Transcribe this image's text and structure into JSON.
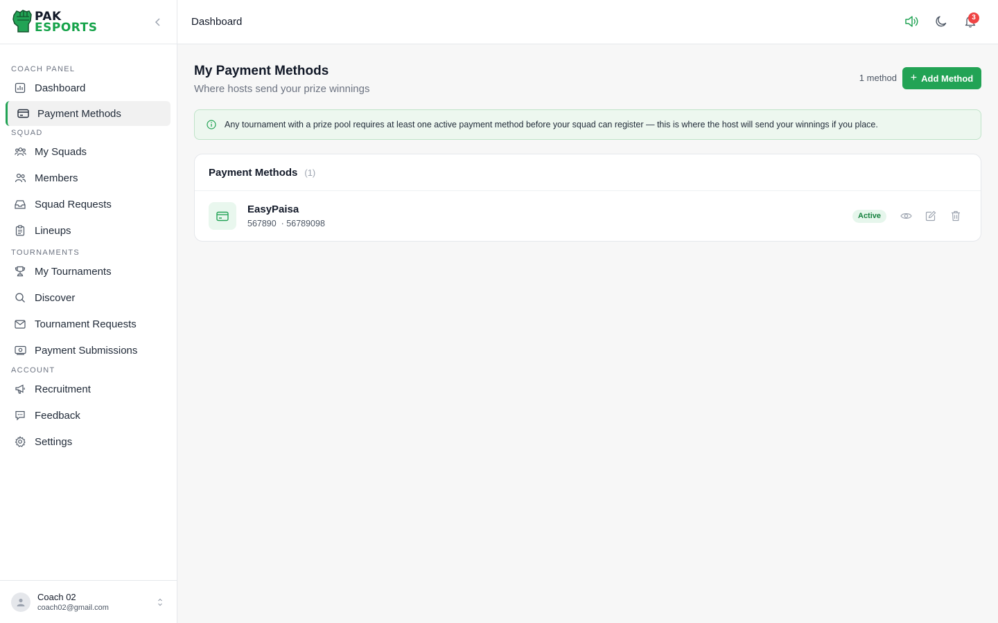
{
  "brand": {
    "line1": "PAK",
    "line2": "ESPORTS"
  },
  "sidebar": {
    "sections": [
      {
        "label": "COACH PANEL",
        "items": [
          {
            "label": "Dashboard",
            "icon": "chart-bar-icon"
          },
          {
            "label": "Payment Methods",
            "icon": "credit-card-icon",
            "active": true
          }
        ]
      },
      {
        "label": "SQUAD",
        "items": [
          {
            "label": "My Squads",
            "icon": "users-group-icon"
          },
          {
            "label": "Members",
            "icon": "users-icon"
          },
          {
            "label": "Squad Requests",
            "icon": "inbox-icon"
          },
          {
            "label": "Lineups",
            "icon": "clipboard-icon"
          }
        ]
      },
      {
        "label": "TOURNAMENTS",
        "items": [
          {
            "label": "My Tournaments",
            "icon": "trophy-icon"
          },
          {
            "label": "Discover",
            "icon": "search-icon"
          },
          {
            "label": "Tournament Requests",
            "icon": "mail-icon"
          },
          {
            "label": "Payment Submissions",
            "icon": "cash-icon"
          }
        ]
      },
      {
        "label": "ACCOUNT",
        "items": [
          {
            "label": "Recruitment",
            "icon": "megaphone-icon"
          },
          {
            "label": "Feedback",
            "icon": "message-icon"
          },
          {
            "label": "Settings",
            "icon": "gear-icon"
          }
        ]
      }
    ]
  },
  "user": {
    "name": "Coach 02",
    "email": "coach02@gmail.com"
  },
  "topbar": {
    "breadcrumb": "Dashboard",
    "notification_count": "3"
  },
  "page": {
    "title": "My Payment Methods",
    "subtitle": "Where hosts send your prize winnings",
    "count_text": "1 method",
    "add_label": "Add Method"
  },
  "alert": {
    "text": "Any tournament with a prize pool requires at least one active payment method before your squad can register — this is where the host will send your winnings if you place."
  },
  "methods_card": {
    "title": "Payment Methods",
    "count": "(1)",
    "items": [
      {
        "name": "EasyPaisa",
        "detail": "567890  · 56789098",
        "status": "Active"
      }
    ]
  },
  "colors": {
    "accent": "#22a355",
    "badge": "#ef4444"
  }
}
